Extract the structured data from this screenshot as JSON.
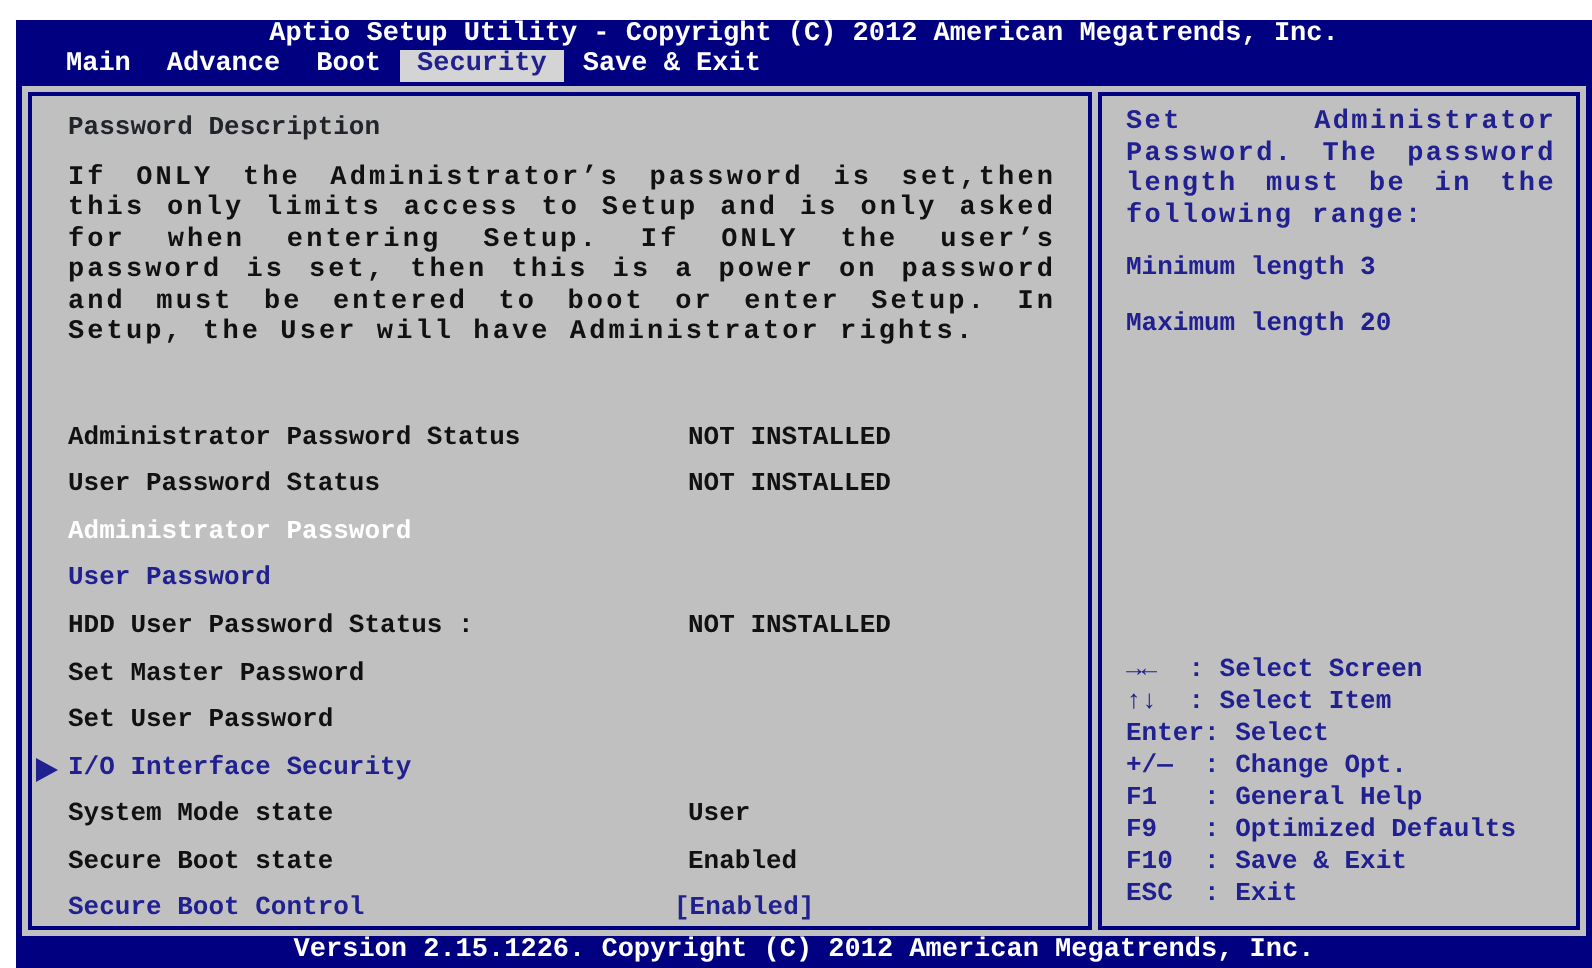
{
  "window": {
    "title": "Aptio Setup Utility - Copyright (C) 2012 American Megatrends, Inc."
  },
  "tabs": [
    {
      "label": "Main",
      "selected": false
    },
    {
      "label": "Advance",
      "selected": false
    },
    {
      "label": "Boot",
      "selected": false
    },
    {
      "label": "Security",
      "selected": true
    },
    {
      "label": "Save & Exit",
      "selected": false
    }
  ],
  "description": {
    "title": "Password Description",
    "text": "If ONLY the Administrator’s password is set,then this only limits access to Setup and is only asked for when entering Setup. If ONLY the user’s password is set, then this is a power on password and must be entered to boot or enter Setup. In Setup, the User will have Administrator rights."
  },
  "items": [
    {
      "kind": "info",
      "label": "Administrator Password Status",
      "value": "NOT INSTALLED",
      "selected": false
    },
    {
      "kind": "info",
      "label": "User Password Status",
      "value": "NOT INSTALLED",
      "selected": false
    },
    {
      "kind": "option",
      "label": "Administrator Password",
      "selected": true
    },
    {
      "kind": "option",
      "label": "User Password",
      "selected": false
    },
    {
      "kind": "info",
      "label": "HDD User Password Status :",
      "value": "NOT INSTALLED",
      "selected": false
    },
    {
      "kind": "info",
      "label": "Set Master Password",
      "selected": false
    },
    {
      "kind": "info",
      "label": "Set User Password",
      "selected": false
    },
    {
      "kind": "submenu",
      "label": "I/O Interface Security",
      "selected": false
    },
    {
      "kind": "info",
      "label": "System Mode state",
      "value": "User",
      "selected": false
    },
    {
      "kind": "info",
      "label": "Secure Boot state",
      "value": "Enabled",
      "selected": false
    },
    {
      "kind": "option",
      "label": "Secure Boot Control",
      "value": "[Enabled]",
      "selected": false
    }
  ],
  "help": {
    "text": "Set Administrator Password. The password length must be in the following range:",
    "lines": [
      "Minimum length 3",
      "Maximum length 20"
    ]
  },
  "keys": [
    "→←  : Select Screen",
    "↑↓  : Select Item",
    "Enter: Select",
    "+/—  : Change Opt.",
    "F1   : General Help",
    "F9   : Optimized Defaults",
    "F10  : Save & Exit",
    "ESC  : Exit"
  ],
  "status_bar": "Version 2.15.1226. Copyright (C) 2012 American Megatrends, Inc."
}
